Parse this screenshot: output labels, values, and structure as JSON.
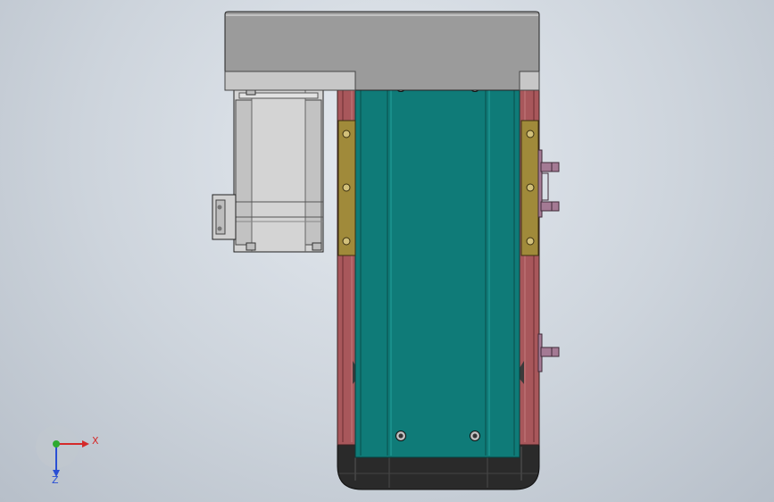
{
  "viewport": {
    "background_top": "#e4e9ef",
    "background_bottom": "#b7bfc9"
  },
  "model": {
    "top_plate_color": "#9b9b9b",
    "carriage_color": "#0f7b78",
    "rail_color": "#a8575b",
    "bracket_color": "#a08a3a",
    "motor_color": "#d4d4d4",
    "end_cap_color": "#2a2a2a",
    "fixture_color": "#a47a94"
  },
  "triad": {
    "x_label": "X",
    "z_label": "Z",
    "x_color": "#d42a2a",
    "y_color": "#2faa2f",
    "z_color": "#2a4fd4"
  }
}
